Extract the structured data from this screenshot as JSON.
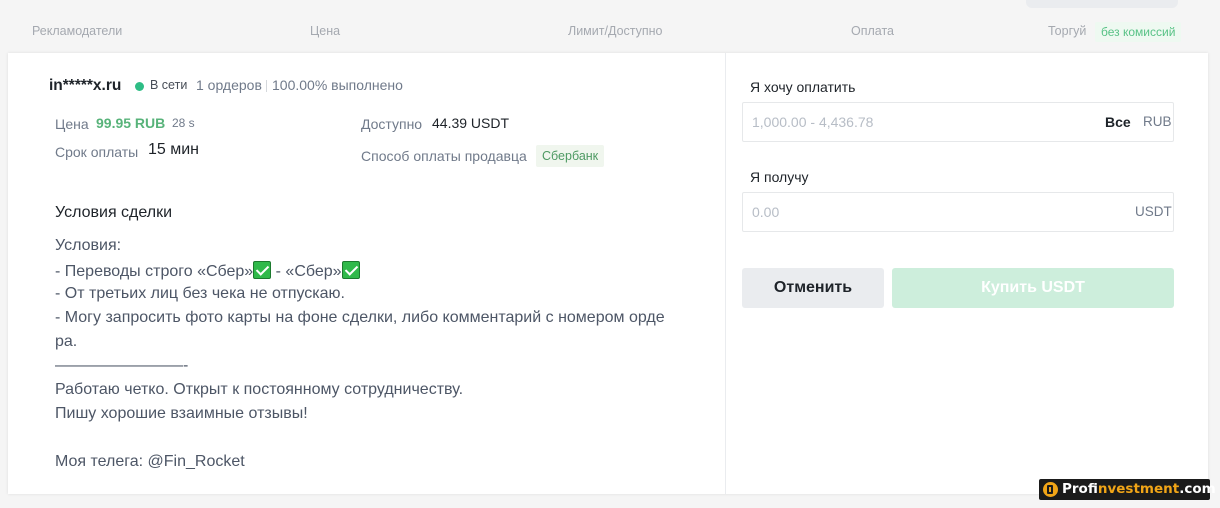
{
  "columns": {
    "advertisers": "Рекламодатели",
    "price": "Цена",
    "limit": "Лимит/Доступно",
    "payment": "Оплата",
    "trade": "Торгуй",
    "fee_badge": "без комиссий"
  },
  "advertiser": {
    "name": "in*****x.ru",
    "status": "В сети",
    "orders": "1 ордеров",
    "completion": "100.00% выполнено"
  },
  "details": {
    "price_label": "Цена",
    "price_value": "99.95 RUB",
    "timer": "28 s",
    "term_label": "Срок оплаты",
    "term_value": "15 мин",
    "available_label": "Доступно",
    "available_value": "44.39 USDT",
    "method_label": "Способ оплаты продавца",
    "method_value": "Сбербанк"
  },
  "terms": {
    "title": "Условия сделки",
    "heading": "Условия:",
    "line1a": "- Переводы строго «Сбер»",
    "line1b": " - «Сбер»",
    "line2": "- От третьих лиц без чека не отпускаю.",
    "line3": "- Могу запросить фото карты на фоне сделки, либо комментарий с номером орде",
    "line3b": "ра.",
    "line4": "————————-",
    "line5": "Работаю четко. Открыт к постоянному сотрудничеству.",
    "line6": "Пишу хорошие взаимные отзывы!",
    "line7": "Моя телега: @Fin_Rocket"
  },
  "order_form": {
    "pay_label": "Я хочу оплатить",
    "pay_placeholder": "1,000.00 - 4,436.78",
    "all_label": "Все",
    "pay_currency": "RUB",
    "receive_label": "Я получу",
    "receive_placeholder": "0.00",
    "receive_currency": "USDT",
    "cancel_label": "Отменить",
    "buy_label": "Купить USDT"
  },
  "watermark": {
    "part1": "Prof",
    "part2": "investment",
    "part3": ".com"
  },
  "colors": {
    "accent_green": "#2ebd85",
    "buy_disabled": "#cdeedc",
    "brand_orange": "#f1a517"
  }
}
